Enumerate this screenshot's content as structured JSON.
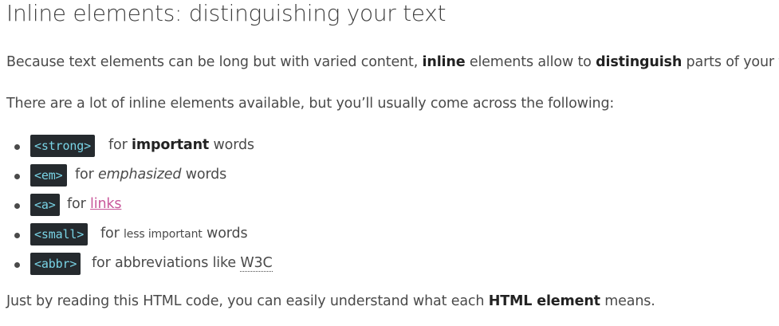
{
  "title": "Inline elements: distinguishing your text",
  "p1": {
    "a": "Because text elements can be long but with varied content, ",
    "b": "inline",
    "c": " elements allow to ",
    "d": "distinguish",
    "e": " parts of your text."
  },
  "p2": "There are a lot of inline elements available, but you’ll usually come across the following:",
  "items": [
    {
      "code": "<strong>",
      "pre": "for ",
      "key": "important",
      "post": " words"
    },
    {
      "code": "<em>",
      "pre": "for ",
      "key": "emphasized",
      "post": " words"
    },
    {
      "code": "<a>",
      "pre": "for ",
      "key": "links",
      "post": ""
    },
    {
      "code": "<small>",
      "pre": "for ",
      "key": "less important",
      "post": " words"
    },
    {
      "code": "<abbr>",
      "pre": "for abbreviations like ",
      "key": "W3C",
      "post": ""
    }
  ],
  "p3": {
    "a": "Just by reading this HTML code, you can easily understand what each ",
    "b": "HTML element",
    "c": " means."
  },
  "colors": {
    "code_bg": "#252a2e",
    "code_text": "#79d4e6",
    "link": "#c8579a"
  }
}
